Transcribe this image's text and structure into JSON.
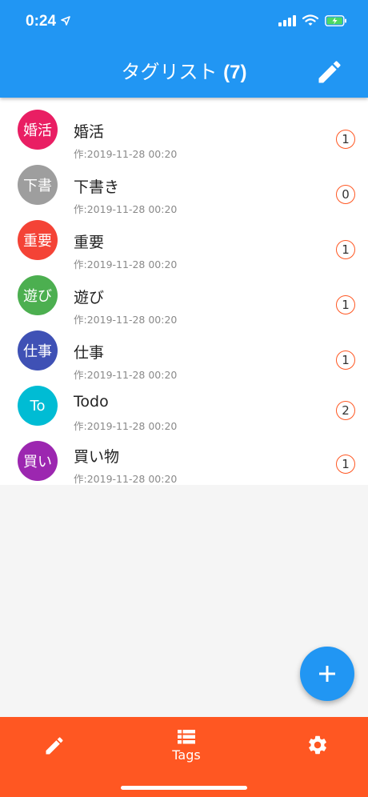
{
  "status_bar": {
    "time": "0:24"
  },
  "header": {
    "title": "タグリスト",
    "count": "(7)"
  },
  "tags": [
    {
      "avatar": "婚活",
      "name": "婚活",
      "date": "作:2019-11-28 00:20",
      "count": "1",
      "color": "#e91e63"
    },
    {
      "avatar": "下書",
      "name": "下書き",
      "date": "作:2019-11-28 00:20",
      "count": "0",
      "color": "#9e9e9e"
    },
    {
      "avatar": "重要",
      "name": "重要",
      "date": "作:2019-11-28 00:20",
      "count": "1",
      "color": "#f44336"
    },
    {
      "avatar": "遊び",
      "name": "遊び",
      "date": "作:2019-11-28 00:20",
      "count": "1",
      "color": "#4caf50"
    },
    {
      "avatar": "仕事",
      "name": "仕事",
      "date": "作:2019-11-28 00:20",
      "count": "1",
      "color": "#3f51b5"
    },
    {
      "avatar": "To",
      "name": "Todo",
      "date": "作:2019-11-28 00:20",
      "count": "2",
      "color": "#00bcd4"
    },
    {
      "avatar": "買い",
      "name": "買い物",
      "date": "作:2019-11-28 00:20",
      "count": "1",
      "color": "#9c27b0"
    }
  ],
  "bottom_nav": {
    "tags_label": "Tags"
  },
  "colors": {
    "primary": "#2196f3",
    "accent": "#ff5722"
  },
  "icons": {
    "header_edit": "pencil-icon",
    "fab": "plus-icon",
    "nav_left": "pencil-icon",
    "nav_center": "list-icon",
    "nav_right": "gear-icon"
  }
}
